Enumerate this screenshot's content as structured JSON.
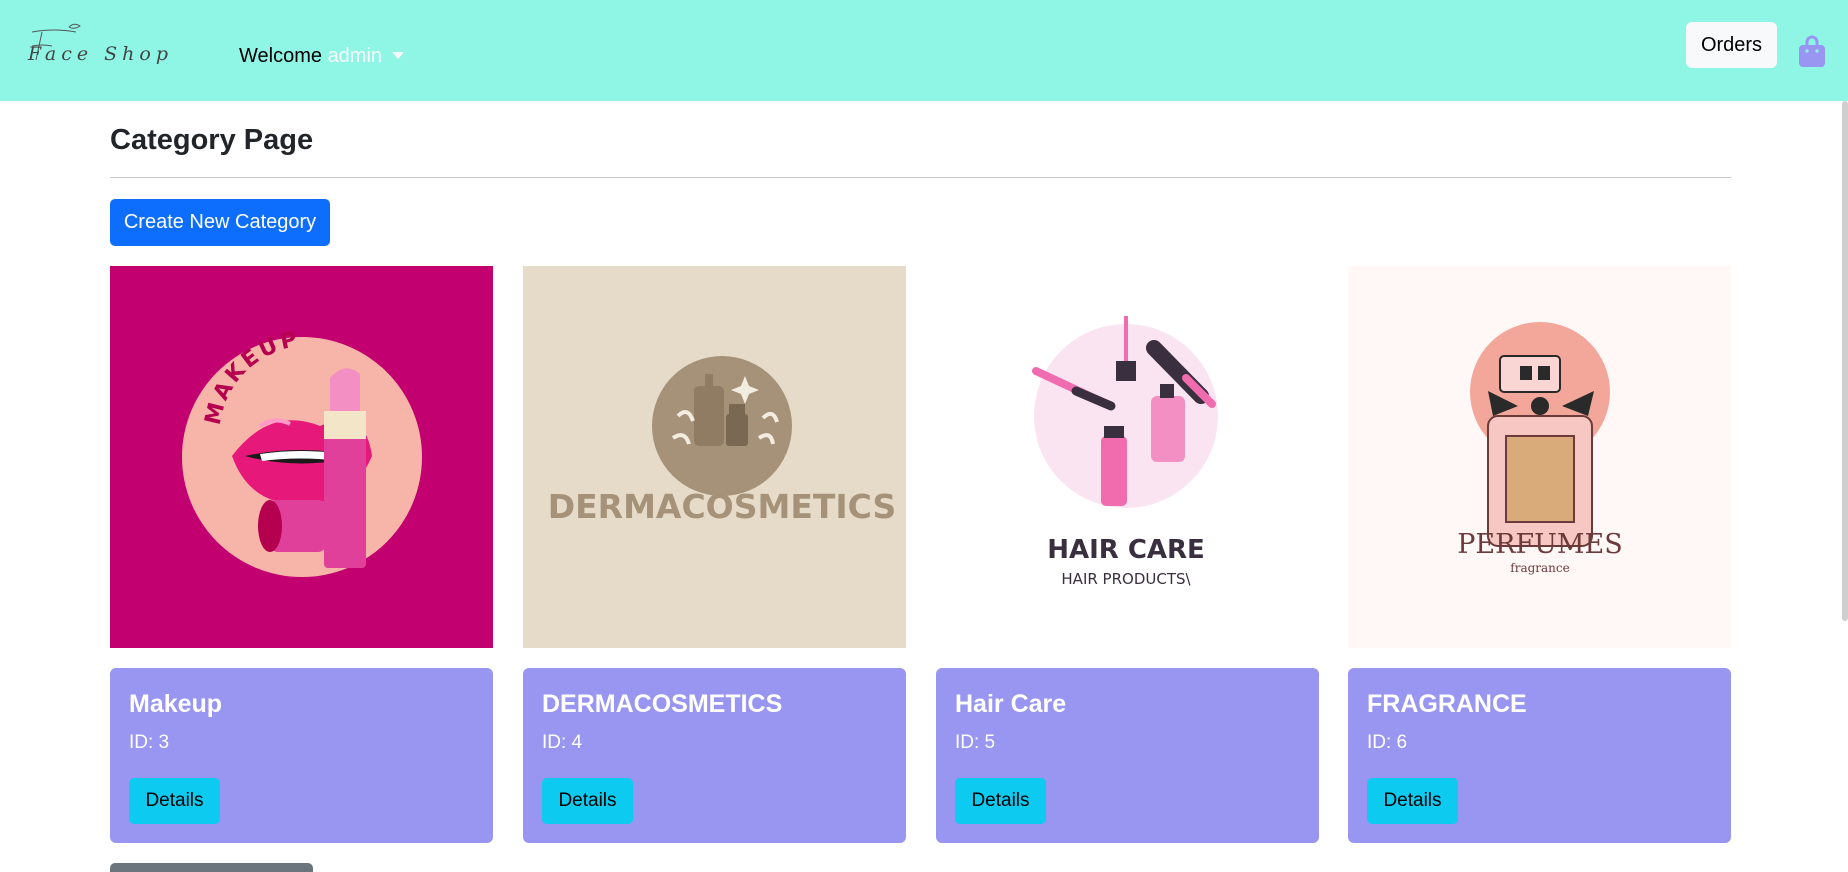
{
  "header": {
    "brand": "Face Shop",
    "welcome_prefix": "Welcome",
    "username": "admin",
    "orders_label": "Orders",
    "cart_icon": "shopping-bag-icon",
    "cart_color": "#9896f1"
  },
  "main": {
    "title": "Category Page",
    "create_button_label": "Create New Category",
    "more_button_label": ""
  },
  "colors": {
    "navbar": "#8ff6e6",
    "primary_button": "#0d6efd",
    "card_body": "#9896f1",
    "details_button": "#0dcaf0"
  },
  "categories": [
    {
      "name": "Makeup",
      "id_label": "ID: 3",
      "details_label": "Details",
      "image_text": "MAKEUP",
      "image_bg": "#c2006f"
    },
    {
      "name": "DERMACOSMETICS",
      "id_label": "ID: 4",
      "details_label": "Details",
      "image_text": "DERMACOSMETICS",
      "image_bg": "#e5dbc8"
    },
    {
      "name": "Hair Care",
      "id_label": "ID: 5",
      "details_label": "Details",
      "image_text": "HAIR CARE",
      "image_subtext": "HAIR PRODUCTS\\",
      "image_bg": "#ffffff"
    },
    {
      "name": "FRAGRANCE",
      "id_label": "ID: 6",
      "details_label": "Details",
      "image_text": "PERFUMES",
      "image_subtext": "fragrance",
      "image_bg": "#fff8f7"
    }
  ]
}
